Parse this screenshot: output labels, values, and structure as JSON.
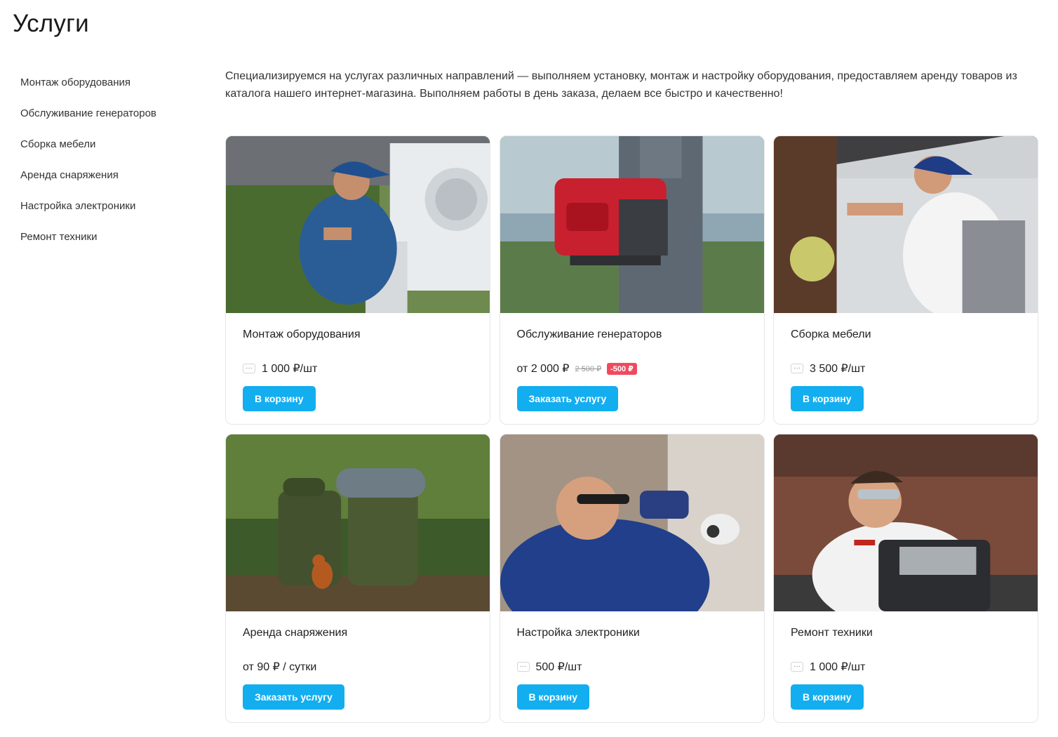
{
  "page": {
    "title": "Услуги"
  },
  "sidebar": {
    "items": [
      {
        "label": "Монтаж оборудования"
      },
      {
        "label": "Обслуживание генераторов"
      },
      {
        "label": "Сборка мебели"
      },
      {
        "label": "Аренда снаряжения"
      },
      {
        "label": "Настройка электроники"
      },
      {
        "label": "Ремонт техники"
      }
    ]
  },
  "intro": {
    "text": "Специализируемся на услугах различных направлений — выполняем установку, монтаж и настройку оборудования, предоставляем аренду товаров из каталога нашего интернет-магазина. Выполняем работы в день заказа, делаем все быстро и качественно!"
  },
  "services": [
    {
      "title": "Монтаж оборудования",
      "price": "1 000 ₽/шт",
      "button": "В корзину",
      "image": "technician-installing-air-conditioner"
    },
    {
      "title": "Обслуживание генераторов",
      "price": "от 2 000 ₽",
      "old_price": "2 500 ₽",
      "discount": "-500 ₽",
      "button": "Заказать услугу",
      "image": "person-carrying-red-generator"
    },
    {
      "title": "Сборка мебели",
      "price": "3 500 ₽/шт",
      "button": "В корзину",
      "image": "worker-assembling-kitchen-cabinet"
    },
    {
      "title": "Аренда снаряжения",
      "price": "от 90 ₽ / сутки",
      "button": "Заказать услугу",
      "image": "hiking-backpacks-in-forest-with-squirrel"
    },
    {
      "title": "Настройка электроники",
      "price": "500 ₽/шт",
      "button": "В корзину",
      "image": "man-installing-security-camera"
    },
    {
      "title": "Ремонт техники",
      "price": "1 000 ₽/шт",
      "button": "В корзину",
      "image": "man-repairing-coffee-machine"
    }
  ],
  "colors": {
    "accent": "#12aef0",
    "discount": "#f04a5f"
  },
  "icons": {
    "quantity": "dots-icon"
  }
}
